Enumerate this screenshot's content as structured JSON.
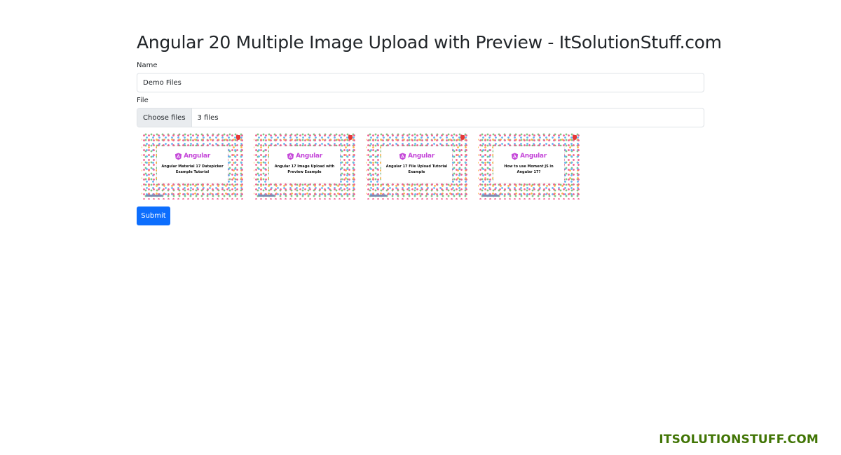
{
  "page": {
    "title": "Angular 20 Multiple Image Upload with Preview - ItSolutionStuff.com"
  },
  "form": {
    "name_label": "Name",
    "name_value": "Demo Files",
    "file_label": "File",
    "file_button_label": "Choose files",
    "file_status": "3 files",
    "submit_label": "Submit"
  },
  "previews": [
    {
      "brand": "Angular",
      "title": "Angular Material 17 Datepicker Example Tutorial"
    },
    {
      "brand": "Angular",
      "title": "Angular 17 Image Upload with Preview Example"
    },
    {
      "brand": "Angular",
      "title": "Angular 17 File Upload Tutorial Example"
    },
    {
      "brand": "Angular",
      "title": "How to use Moment JS in Angular 17?"
    }
  ],
  "watermark": "ITSOLUTIONSTUFF.COM",
  "colors": {
    "primary": "#0d6efd",
    "angular_brand": "#c548d9",
    "watermark": "#417505",
    "text": "#212529",
    "border": "#dee2e6"
  },
  "icons": {
    "thumbnail_logo": "angular-logo-icon"
  }
}
